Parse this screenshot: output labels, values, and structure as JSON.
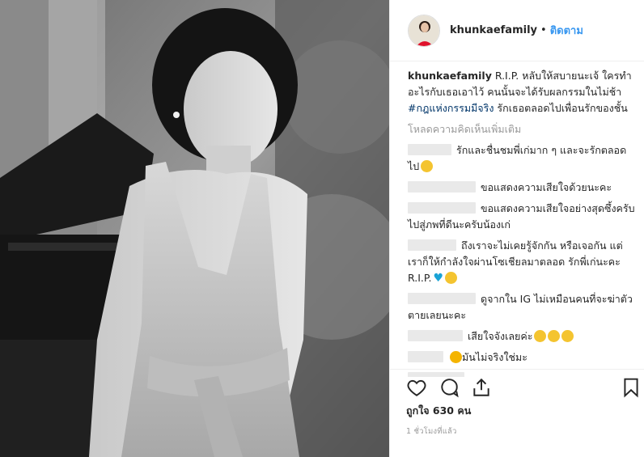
{
  "post": {
    "username": "khunkaefamily",
    "dot": "•",
    "follow_label": "ติดตาม",
    "caption": {
      "username": "khunkaefamily",
      "text_before": " R.I.P. หลับให้สบายนะเจ้ ใครทำอะไรกับเธอเอาไว้ คนนั้นจะได้รับผลกรรมในไม่ช้า ",
      "hashtag": "#กฎแห่งกรรมมีจริง",
      "text_after": " รักเธอตลอดไปเพื่อนรักของชั้น"
    },
    "load_more_label": "โหลดความคิดเห็นเพิ่มเติม",
    "comments": [
      {
        "text": "รักและชื่นชมพี่เก่มาก ๆ และจะรักตลอดไป",
        "emojis": [
          "crying-face-icon"
        ]
      },
      {
        "text": "ขอแสดงความเสียใจด้วยนะคะ",
        "emojis": []
      },
      {
        "text": "ขอแสดงความเสียใจอย่างสุดซึ้งครับ ไปสู่ภพที่ดีนะครับน้องเก่",
        "emojis": []
      },
      {
        "text": "ถึงเราจะไม่เคยรู้จักกัน หรือเจอกัน แต่เราก็ให้กำลังใจผ่านโซเชียลมาตลอด รักพี่เก่นะคะ R.I.P.",
        "emojis": [
          "blue-heart-icon",
          "crying-face-icon"
        ]
      },
      {
        "text": "ดูจากใน IG ไม่เหมือนคนที่จะฆ่าตัวตายเลยนะคะ",
        "emojis": []
      },
      {
        "text": "เสียใจจังเลยค่ะ",
        "emojis": [
          "crying-face-icon",
          "crying-face-icon",
          "crying-face-icon"
        ]
      },
      {
        "text": "มันไม่จริงใช่มะ",
        "emojis": [
          "sad-face-icon"
        ]
      }
    ],
    "likes_label": "ถูกใจ 630 คน",
    "time_ago": "1 ชั่วโมงที่แล้ว",
    "colors": {
      "link": "#3897f0",
      "hashtag": "#003569",
      "muted": "#999999"
    }
  }
}
